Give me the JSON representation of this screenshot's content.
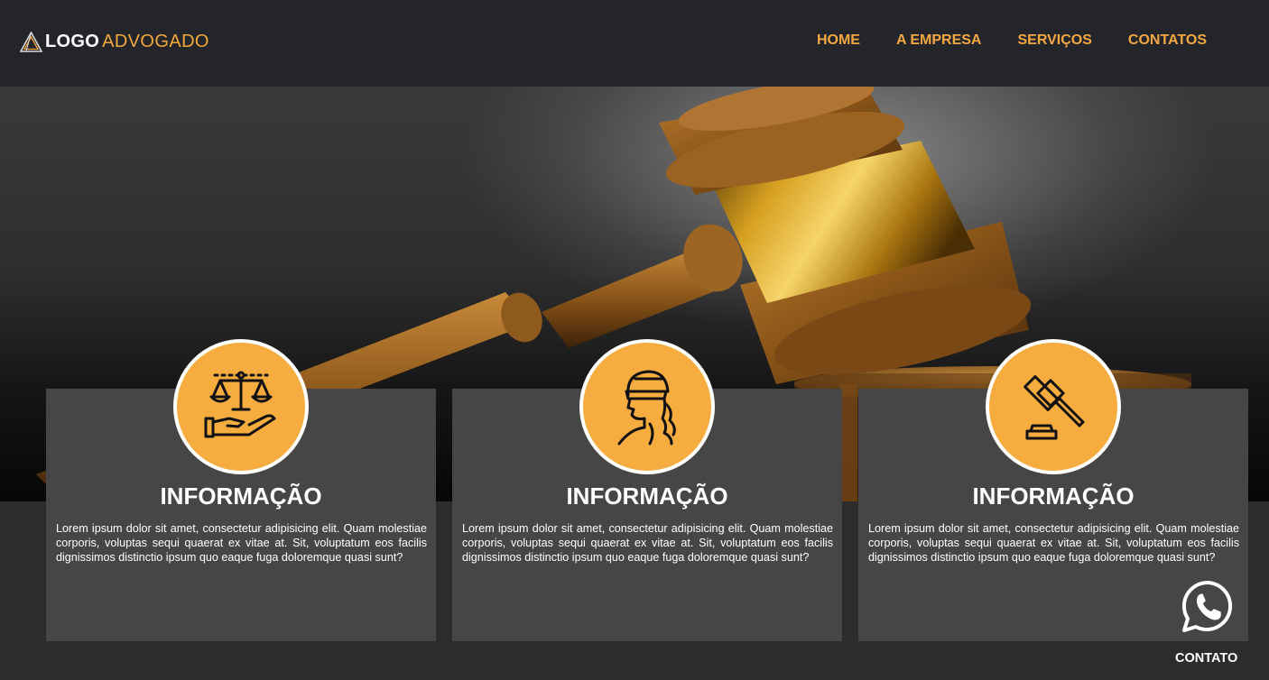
{
  "header": {
    "logo_bold": "LOGO",
    "logo_light": "ADVOGADO",
    "nav": [
      "HOME",
      "A EMPRESA",
      "SERVIÇOS",
      "CONTATOS"
    ]
  },
  "hero": {
    "image": "wooden judge gavel with golden band on a dark textured background"
  },
  "cards": [
    {
      "icon": "scales-in-hand-icon",
      "title": "INFORMAÇÃO",
      "text": "Lorem ipsum dolor sit amet, consectetur adipisicing elit. Quam molestiae corporis, voluptas sequi quaerat ex vitae at. Sit, voluptatum eos facilis dignissimos distinctio ipsum quo eaque fuga doloremque quasi sunt?"
    },
    {
      "icon": "blindfolded-justice-icon",
      "title": "INFORMAÇÃO",
      "text": "Lorem ipsum dolor sit amet, consectetur adipisicing elit. Quam molestiae corporis, voluptas sequi quaerat ex vitae at. Sit, voluptatum eos facilis dignissimos distinctio ipsum quo eaque fuga doloremque quasi sunt?"
    },
    {
      "icon": "gavel-icon",
      "title": "INFORMAÇÃO",
      "text": "Lorem ipsum dolor sit amet, consectetur adipisicing elit. Quam molestiae corporis, voluptas sequi quaerat ex vitae at. Sit, voluptatum eos facilis dignissimos distinctio ipsum quo eaque fuga doloremque quasi sunt?"
    }
  ],
  "contact_widget": {
    "icon": "whatsapp-icon",
    "label": "CONTATO"
  },
  "colors": {
    "accent": "#f6ac3e",
    "header_bg": "#23252b",
    "card_bg": "#464646",
    "page_bg": "#2c2c2d"
  }
}
